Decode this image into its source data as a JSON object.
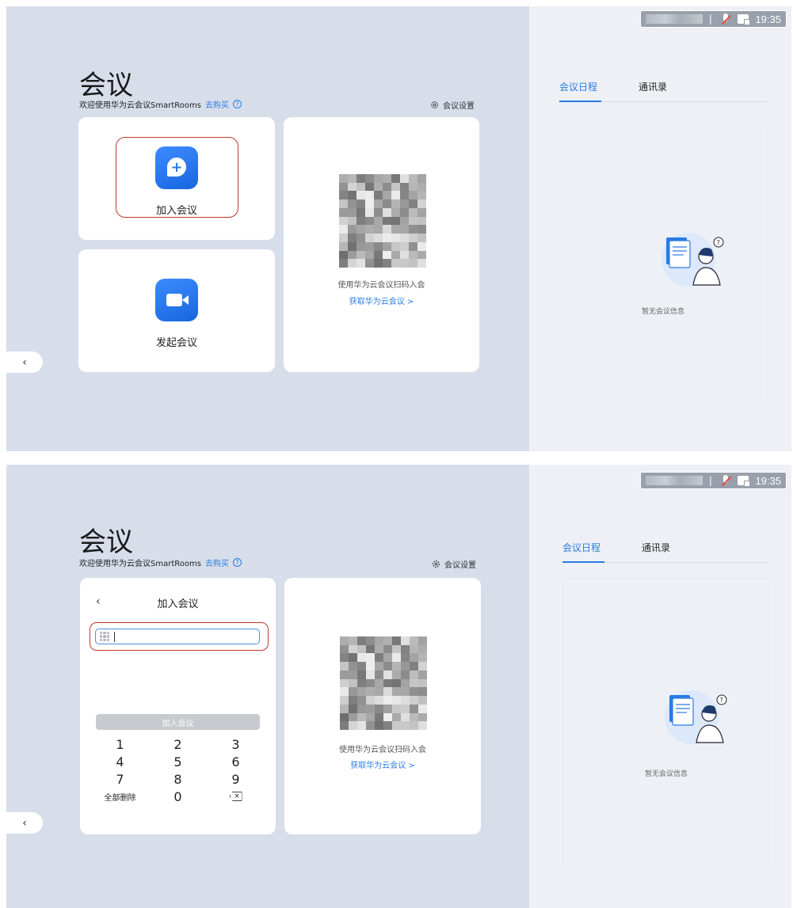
{
  "status_bar": {
    "time": "19:35"
  },
  "header": {
    "title": "会议",
    "welcome": "欢迎使用华为云会议SmartRooms",
    "buy_link": "去购买",
    "help_icon": "?",
    "settings_label": "会议设置"
  },
  "cards": {
    "join": {
      "label": "加入会议"
    },
    "start": {
      "label": "发起会议"
    },
    "qr": {
      "caption": "使用华为云会议扫码入会",
      "link": "获取华为云会议 >"
    }
  },
  "sidebar": {
    "tabs": [
      {
        "label": "会议日程",
        "active": true
      },
      {
        "label": "通讯录",
        "active": false
      }
    ],
    "empty_text": "暂无会议信息"
  },
  "collapse_button": {
    "icon": "‹"
  },
  "join_form": {
    "back_icon": "‹",
    "title": "加入会议",
    "input_value": "",
    "submit_label": "加入会议",
    "keys": [
      "1",
      "2",
      "3",
      "4",
      "5",
      "6",
      "7",
      "8",
      "9",
      "全部删除",
      "0",
      "⌫"
    ]
  },
  "colors": {
    "accent": "#2a7be4",
    "highlight": "#c0392b",
    "panel_bg": "#d7deea"
  },
  "icons": [
    "help-icon",
    "gear-icon",
    "join-meeting-icon",
    "start-meeting-icon",
    "qr-code",
    "back-icon",
    "keypad-icon",
    "backspace-icon",
    "chevron-left-icon",
    "microphone-muted-icon",
    "screen-share-icon"
  ]
}
